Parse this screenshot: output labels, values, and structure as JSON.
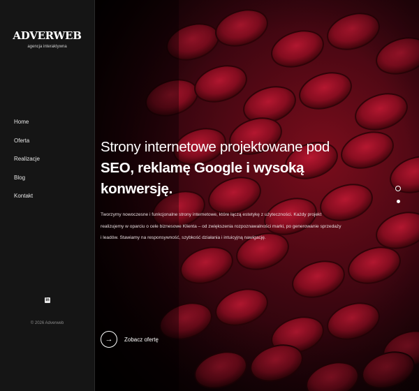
{
  "sidebar": {
    "logo": "ADVERWEB",
    "tagline": "agencja interaktywna",
    "nav": [
      {
        "label": "Home"
      },
      {
        "label": "Oferta"
      },
      {
        "label": "Realizacje"
      },
      {
        "label": "Blog"
      },
      {
        "label": "Kontakt"
      }
    ],
    "social_icon": "linkedin-icon",
    "social_glyph": "in",
    "copyright": "© 2026 Adverweb"
  },
  "hero": {
    "title_light": "Strony internetowe projektowane pod",
    "title_bold": "SEO, reklamę Google i wysoką konwersję.",
    "description": "Tworzymy nowoczesne i funkcjonalne strony internetowe, które łączą estetykę z użyteczności. Każdy projekt realizujemy w oparciu o cele biznesowe Klienta – od zwiększenia rozpoznawalności marki, po generowanie sprzedaży i leadów. Stawiamy na responsywność, szybkość działania i intuicyjną nawigację.",
    "cta_label": "Zobacz ofertę",
    "cta_icon": "arrow-right-icon",
    "cta_glyph": "→"
  },
  "slider": {
    "dots": 2,
    "active_index": 1
  },
  "colors": {
    "sidebar_bg": "#151515",
    "accent": "#8a0f22",
    "text": "#ffffff"
  }
}
